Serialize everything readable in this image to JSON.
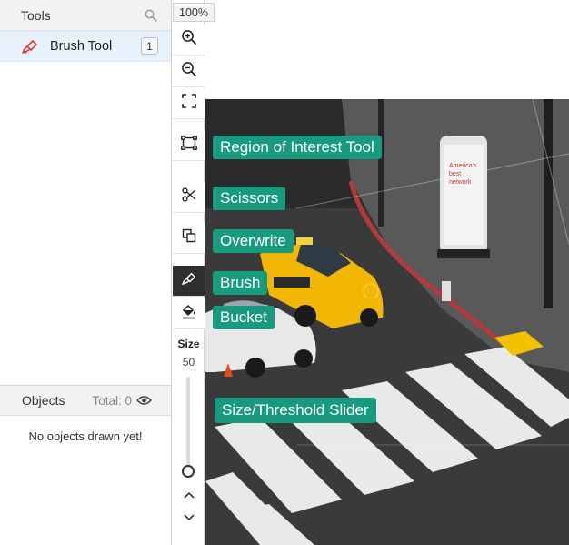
{
  "tools_panel": {
    "title": "Tools",
    "search_icon": "search-icon",
    "items": [
      {
        "label": "Brush Tool",
        "icon": "brush-icon",
        "count": "1",
        "selected": true
      }
    ]
  },
  "objects_panel": {
    "title": "Objects",
    "total": "Total: 0",
    "visibility_icon": "eye-icon",
    "empty_message": "No objects drawn yet!"
  },
  "toolbar": {
    "zoom": "100%",
    "buttons": [
      {
        "id": "zoom-in",
        "icon": "zoom-in-icon"
      },
      {
        "id": "zoom-out",
        "icon": "zoom-out-icon"
      },
      {
        "id": "fullscreen",
        "icon": "fullscreen-icon"
      },
      {
        "id": "region-of-interest",
        "icon": "region-of-interest-icon"
      },
      {
        "id": "scissors",
        "icon": "scissors-icon"
      },
      {
        "id": "overwrite",
        "icon": "overwrite-icon"
      },
      {
        "id": "brush",
        "icon": "brush-icon",
        "active": true
      },
      {
        "id": "bucket",
        "icon": "bucket-icon"
      }
    ],
    "size_label": "Size",
    "size_value": "50",
    "slider_fraction": 0.0
  },
  "tooltips": {
    "region_of_interest": "Region of Interest Tool",
    "scissors": "Scissors",
    "overwrite": "Overwrite",
    "brush": "Brush",
    "bucket": "Bucket",
    "slider": "Size/Threshold Slider"
  },
  "canvas": {
    "image_description_icon": "street-photo"
  },
  "colors": {
    "accent": "#179a7e",
    "selected_row": "#e7f1fb",
    "active_tool": "#2f2f2f",
    "brush_red": "#e53935"
  }
}
